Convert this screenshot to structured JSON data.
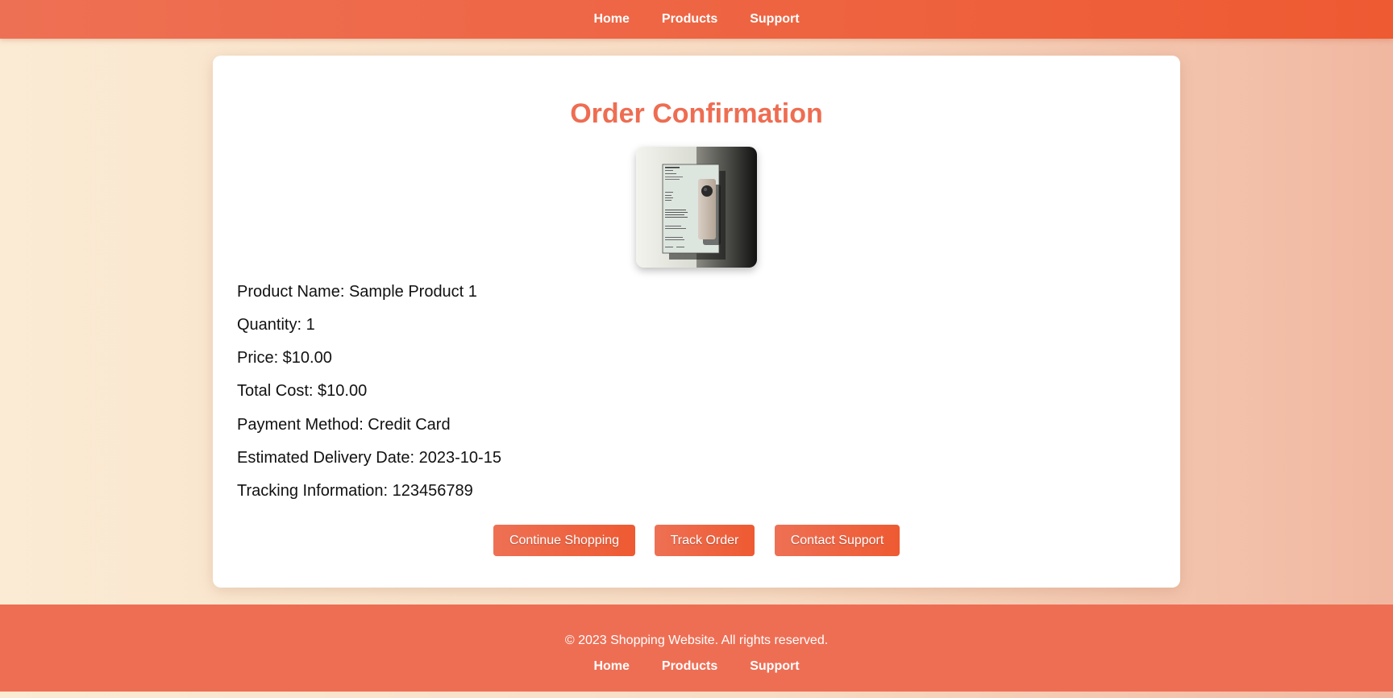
{
  "nav": {
    "home": "Home",
    "products": "Products",
    "support": "Support"
  },
  "page": {
    "title": "Order Confirmation"
  },
  "product_image": {
    "label": "Product 1"
  },
  "details": {
    "product_name": "Product Name: Sample Product 1",
    "quantity": "Quantity: 1",
    "price": "Price: $10.00",
    "total_cost": "Total Cost: $10.00",
    "payment_method": "Payment Method: Credit Card",
    "delivery_date": "Estimated Delivery Date: 2023-10-15",
    "tracking": "Tracking Information: 123456789"
  },
  "buttons": {
    "continue_shopping": "Continue Shopping",
    "track_order": "Track Order",
    "contact_support": "Contact Support"
  },
  "footer": {
    "copyright": "© 2023 Shopping Website. All rights reserved.",
    "home": "Home",
    "products": "Products",
    "support": "Support"
  },
  "colors": {
    "accent": "#ee6d52",
    "accent_dark": "#ee5a32",
    "background_light": "#fbebd4",
    "background_right": "#f1b7a0"
  }
}
